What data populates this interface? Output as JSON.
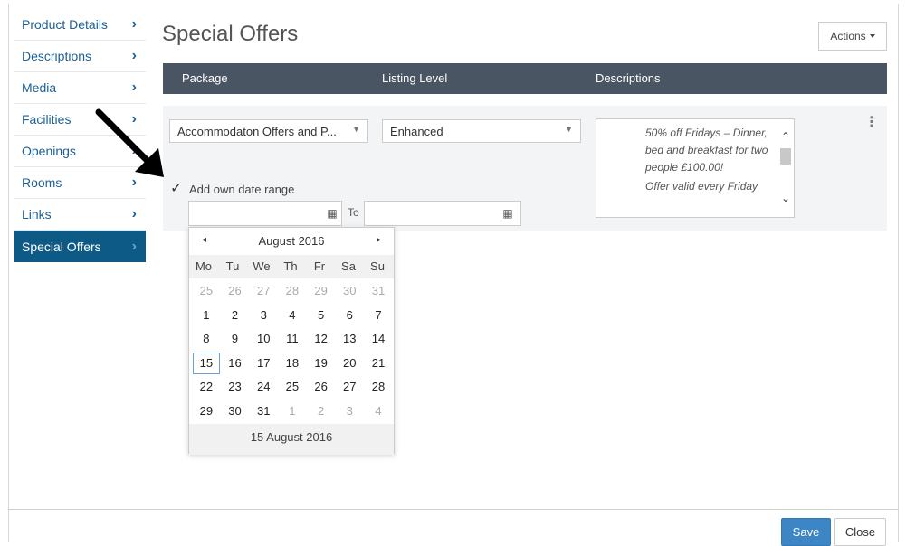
{
  "sidebar": {
    "items": [
      {
        "label": "Product Details",
        "active": false
      },
      {
        "label": "Descriptions",
        "active": false
      },
      {
        "label": "Media",
        "active": false
      },
      {
        "label": "Facilities",
        "active": false
      },
      {
        "label": "Openings",
        "active": false
      },
      {
        "label": "Rooms",
        "active": false
      },
      {
        "label": "Links",
        "active": false
      },
      {
        "label": "Special Offers",
        "active": true
      }
    ]
  },
  "page": {
    "title": "Special Offers",
    "actions_label": "Actions"
  },
  "table": {
    "headers": [
      "Package",
      "Listing Level",
      "Descriptions"
    ]
  },
  "row": {
    "package_value": "Accommodaton Offers and P...",
    "listing_level_value": "Enhanced",
    "description_lines": [
      "50% off Fridays – Dinner, bed and breakfast for two people £100.00!",
      "Offer valid every Friday"
    ],
    "add_own_date_range_label": "Add own date range",
    "add_own_date_range_checked": true,
    "to_label": "To",
    "from_date_value": "",
    "to_date_value": ""
  },
  "calendar": {
    "month_label": "August 2016",
    "prev_symbol": "◂",
    "next_symbol": "▸",
    "weekdays": [
      "Mo",
      "Tu",
      "We",
      "Th",
      "Fr",
      "Sa",
      "Su"
    ],
    "weeks": [
      [
        {
          "d": "25",
          "m": true
        },
        {
          "d": "26",
          "m": true
        },
        {
          "d": "27",
          "m": true
        },
        {
          "d": "28",
          "m": true
        },
        {
          "d": "29",
          "m": true
        },
        {
          "d": "30",
          "m": true
        },
        {
          "d": "31",
          "m": true
        }
      ],
      [
        {
          "d": "1"
        },
        {
          "d": "2"
        },
        {
          "d": "3"
        },
        {
          "d": "4"
        },
        {
          "d": "5"
        },
        {
          "d": "6"
        },
        {
          "d": "7"
        }
      ],
      [
        {
          "d": "8"
        },
        {
          "d": "9"
        },
        {
          "d": "10"
        },
        {
          "d": "11"
        },
        {
          "d": "12"
        },
        {
          "d": "13"
        },
        {
          "d": "14"
        }
      ],
      [
        {
          "d": "15",
          "today": true
        },
        {
          "d": "16"
        },
        {
          "d": "17"
        },
        {
          "d": "18"
        },
        {
          "d": "19"
        },
        {
          "d": "20"
        },
        {
          "d": "21"
        }
      ],
      [
        {
          "d": "22"
        },
        {
          "d": "23"
        },
        {
          "d": "24"
        },
        {
          "d": "25"
        },
        {
          "d": "26"
        },
        {
          "d": "27"
        },
        {
          "d": "28"
        }
      ],
      [
        {
          "d": "29"
        },
        {
          "d": "30"
        },
        {
          "d": "31"
        },
        {
          "d": "1",
          "m": true
        },
        {
          "d": "2",
          "m": true
        },
        {
          "d": "3",
          "m": true
        },
        {
          "d": "4",
          "m": true
        }
      ]
    ],
    "today_label": "15 August 2016"
  },
  "footer": {
    "save_label": "Save",
    "close_label": "Close"
  },
  "icons": {
    "chevron": "›",
    "calendar": "▦",
    "kebab": "⋮",
    "checkmark": "✓",
    "select_caret": "▼"
  },
  "colors": {
    "sidebar_active_bg": "#0e5a86",
    "header_bg": "#4a5563",
    "link_blue": "#1d5f95",
    "save_blue": "#3d86c6"
  }
}
